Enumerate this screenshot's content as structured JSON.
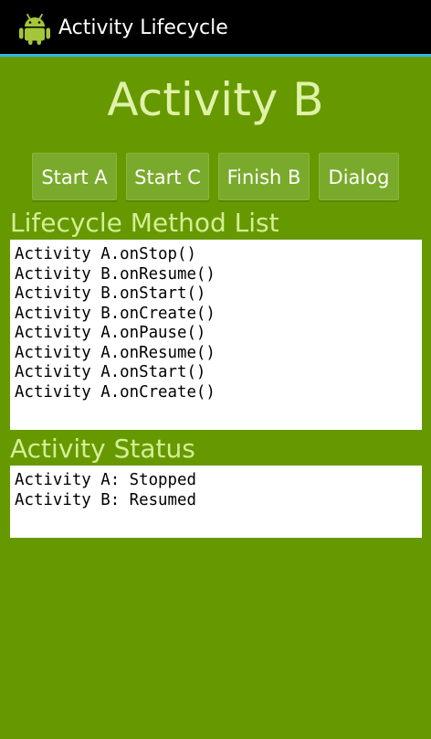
{
  "action_bar": {
    "title": "Activity Lifecycle",
    "icon": "android-robot-icon",
    "background": "#000000",
    "accent": "#33B5E5"
  },
  "heading": "Activity B",
  "buttons": {
    "start_a": "Start A",
    "start_c": "Start C",
    "finish_b": "Finish B",
    "dialog": "Dialog"
  },
  "methods": {
    "label": "Lifecycle Method List",
    "lines": [
      "Activity A.onStop()",
      "Activity B.onResume()",
      "Activity B.onStart()",
      "Activity B.onCreate()",
      "Activity A.onPause()",
      "Activity A.onResume()",
      "Activity A.onStart()",
      "Activity A.onCreate()"
    ]
  },
  "status": {
    "label": "Activity Status",
    "lines": [
      "Activity A: Stopped",
      "Activity B: Resumed"
    ]
  },
  "colors": {
    "background": "#669900",
    "heading": "#E0F2A8",
    "section_label": "#D4EE95",
    "button": "#7AAA2C"
  }
}
